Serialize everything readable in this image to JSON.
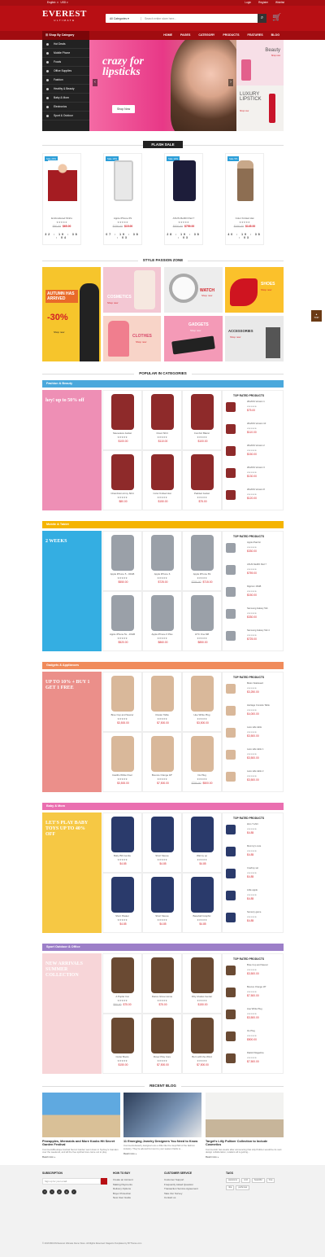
{
  "topbar": {
    "language": "English",
    "currency": "USD",
    "login": "Login",
    "register": "Register",
    "wishlist": "Wishlist"
  },
  "header": {
    "logo": "EVEREST",
    "logo_sub": "ULTIMATE",
    "search_category": "All Categories",
    "search_placeholder": "Search entire store here..."
  },
  "nav": {
    "shop_by_category": "Shop By Category",
    "items": [
      "HOME",
      "PAGES",
      "CATEGORY",
      "PRODUCTS",
      "FEATURES",
      "BLOG"
    ]
  },
  "side_menu": [
    "Hot Deals",
    "Mobile Phone",
    "Foods",
    "Office Supplies",
    "Fashion",
    "Healthy & Beauty",
    "Baby & Mom",
    "Electronics",
    "Sport & Outdoor"
  ],
  "slider": {
    "title_line1": "crazy for",
    "title_line2": "lipsticks",
    "button": "Shop Now"
  },
  "side_banners": [
    {
      "title": "Beauty",
      "sub": "Shop now"
    },
    {
      "title": "LUXURY LIPSTICK",
      "sub": "Shop now"
    }
  ],
  "flash_sale": {
    "title": "FLASH SALE",
    "products": [
      {
        "badge": "Sale 20%",
        "name": "Embroidered Shirts",
        "rating": "★★★★★",
        "old_price": "$80.00",
        "price": "$65.00",
        "countdown": "32 : 19 : 38 : 04"
      },
      {
        "badge": "Sale 10%",
        "name": "Apple iPhone 6S",
        "rating": "★★★★★",
        "old_price": "$750.00",
        "price": "$15.00",
        "countdown": "07 : 19 : 38 : 03"
      },
      {
        "badge": "Sale 12%",
        "name": "ASUS MeMO Pad 7",
        "rating": "★★★★★",
        "old_price": "$820.00",
        "price": "$759.00",
        "countdown": "28 : 19 : 38 : 03"
      },
      {
        "badge": "Sale 5%",
        "name": "Color Knitted Hat",
        "rating": "★★★★★",
        "old_price": "$160.00",
        "price": "$145.00",
        "countdown": "40 : 19 : 38 : 03"
      }
    ]
  },
  "style_zone": {
    "title": "STYLE PASSION ZONE",
    "tiles": [
      {
        "label": "AUTUMN HAS ARRIVED",
        "extra": "-30%",
        "sub": "Shop now"
      },
      {
        "label": "COSMETICS",
        "sub": "Shop now"
      },
      {
        "label": "WATCH",
        "sub": "Shop now"
      },
      {
        "label": "SHOES",
        "sub": "Shop now"
      },
      {
        "label": "CLOTHES",
        "sub": "Shop now"
      },
      {
        "label": "GADGETS",
        "sub": "Shop now"
      },
      {
        "label": "ACCESSORIES",
        "sub": "Shop now"
      }
    ]
  },
  "popular": {
    "title": "POPULAR IN CATEGORIES",
    "top_rated": "TOP RATED PRODUCTS",
    "categories": [
      {
        "name": "Fashion & Beauty",
        "color": "#4aa8dc",
        "banner": "hey! up to 50% off",
        "banner_color": "#ee8fb5",
        "products": [
          {
            "name": "Sleeveless Jacket",
            "old": "",
            "price": "$100.00"
          },
          {
            "name": "Cloud Shirt",
            "old": "",
            "price": "$110.00"
          },
          {
            "name": "Comfort Blazer",
            "old": "",
            "price": "$100.00"
          },
          {
            "name": "Chambrain Army Shirt",
            "old": "",
            "price": "$80.00"
          },
          {
            "name": "Color Knitted Hat",
            "old": "",
            "price": "$150.00"
          },
          {
            "name": "Padded Jacket",
            "old": "",
            "price": "$75.00"
          }
        ],
        "top": [
          {
            "name": "WHASS Version 1",
            "price": "$75.00"
          },
          {
            "name": "WHASS Version 10",
            "price": "$110.00"
          },
          {
            "name": "WHASS Version 2",
            "price": "$150.00"
          },
          {
            "name": "WHASS Version 3",
            "price": "$130.00"
          },
          {
            "name": "WHASS Version 8",
            "price": "$120.00"
          }
        ]
      },
      {
        "name": "Mobile & Tablet",
        "color": "#f5b400",
        "banner": "2 WEEKS",
        "banner_color": "#34aee2",
        "products": [
          {
            "name": "Apple iPhone 5 - 32GB",
            "old": "",
            "price": "$550.00"
          },
          {
            "name": "Apple iPhone 6",
            "old": "",
            "price": "$725.00"
          },
          {
            "name": "Apple iPhone 6S",
            "old": "$750.00",
            "price": "$715.00"
          },
          {
            "name": "Apple iPhone 5s - 16GB",
            "old": "",
            "price": "$520.00"
          },
          {
            "name": "Apple iPhone 6 Plus",
            "old": "",
            "price": "$860.00"
          },
          {
            "name": "HTC One M8",
            "old": "",
            "price": "$850.00"
          }
        ],
        "top": [
          {
            "name": "Apple iPad Air",
            "price": "$330.00"
          },
          {
            "name": "ASUS MeMO Pad 7",
            "price": "$759.00"
          },
          {
            "name": "Digicom 16GB",
            "price": "$150.00"
          },
          {
            "name": "Samsung Galaxy Tab",
            "price": "$330.00"
          },
          {
            "name": "Samsung Galaxy Tab 4",
            "price": "$725.00"
          }
        ]
      },
      {
        "name": "Gadgets & Appliances",
        "color": "#f08b5b",
        "banner": "UP TO 10% + BUY 1 GET 1 FREE",
        "banner_color": "#eb8f8a",
        "products": [
          {
            "name": "Bree Cup and Saucer",
            "old": "",
            "price": "$3,500.00"
          },
          {
            "name": "Cluster Table",
            "old": "",
            "price": "$7,500.00"
          },
          {
            "name": "Hue White Plug",
            "old": "",
            "price": "$3,500.00"
          },
          {
            "name": "Castillo White Floor",
            "old": "",
            "price": "$3,500.00"
          },
          {
            "name": "Bounce Orange 18\"",
            "old": "",
            "price": "$7,500.00"
          },
          {
            "name": "Iris Plug",
            "old": "$750.00",
            "price": "$500.00"
          }
        ],
        "top": [
          {
            "name": "Bistro Sideboard",
            "price": "$3,250.00"
          },
          {
            "name": "Heritage Console Table",
            "price": "$4,000.00"
          },
          {
            "name": "Lace side table",
            "price": "$3,500.00"
          },
          {
            "name": "Lace side table 1",
            "price": "$3,500.00"
          },
          {
            "name": "Lace side table 2",
            "price": "$3,500.00"
          }
        ]
      },
      {
        "name": "Baby & Mom",
        "color": "#ea6fb0",
        "banner": "LET'S PLAY BABY TOYS UP TO 40% OFF",
        "banner_color": "#f6c844",
        "products": [
          {
            "name": "Baby Bib Gentle",
            "old": "",
            "price": "$4.85"
          },
          {
            "name": "Short Sleeve",
            "old": "",
            "price": "$4.85"
          },
          {
            "name": "Warmy up",
            "old": "",
            "price": "$4.85"
          },
          {
            "name": "Short Pleater",
            "old": "",
            "price": "$4.85"
          },
          {
            "name": "Short Sleeve",
            "old": "",
            "price": "$4.85"
          },
          {
            "name": "Baseball Graphic",
            "old": "",
            "price": "$4.85"
          }
        ],
        "top": [
          {
            "name": "Zero T-shirt",
            "price": "$4.85"
          },
          {
            "name": "Mommy's cute",
            "price": "$4.85"
          },
          {
            "name": "Cowboy set",
            "price": "$4.85"
          },
          {
            "name": "Little apple",
            "price": "$4.85"
          },
          {
            "name": "Sensory game",
            "price": "$4.85"
          }
        ]
      },
      {
        "name": "Sport Outdoor & Office",
        "color": "#9c7fc8",
        "banner": "NEW ARRIVALS SUMMER COLLECTION",
        "banner_color": "#f7d5d8",
        "products": [
          {
            "name": "A Poplar Cat",
            "old": "$80.00",
            "price": "$75.00"
          },
          {
            "name": "Dance Glove Home",
            "old": "",
            "price": "$75.00"
          },
          {
            "name": "Fifty shades Genter",
            "old": "",
            "price": "$150.00"
          },
          {
            "name": "Cutter Boots",
            "old": "",
            "price": "$150.00"
          },
          {
            "name": "Rover Play Core",
            "old": "",
            "price": "$7,500.00"
          },
          {
            "name": "Born with the Wind",
            "old": "",
            "price": "$7,500.00"
          }
        ],
        "top": [
          {
            "name": "Bree Cup and Saucer",
            "price": "$3,500.00"
          },
          {
            "name": "Bounce Orange 18\"",
            "price": "$7,500.00"
          },
          {
            "name": "Hue White Plug",
            "price": "$3,500.00"
          },
          {
            "name": "Iris Plug",
            "price": "$500.00"
          },
          {
            "name": "Rattish Magazine",
            "price": "$7,500.00"
          }
        ]
      }
    ]
  },
  "blog": {
    "title": "RECENT BLOG",
    "posts": [
      {
        "title": "Pineapples, Mermaids and More Kooks Hit Secret Garden Festival",
        "desc": "CommentsBoutique festival Secret Garden went down in Sydney's Camden over the weekend, and all the free spirited love came out to play.",
        "more": "Read more »"
      },
      {
        "title": "11 Emerging Jewelry Designers You Need to Know",
        "desc": "CommentsJewelry designers are a little like the stepchild of the fashion industry. They're adored but next to your season fields re...",
        "more": "Read more »"
      },
      {
        "title": "Target's Lilly Pulitzer Collection to Include Cosmetics",
        "desc": "CommentsIt has weeks after announcing that Lilly Pulitzer would be its next design collaboration, retailers all is getting...",
        "more": "Read more »"
      }
    ]
  },
  "footer": {
    "subscription": "SUBSCRIPTION",
    "email_placeholder": "Sign up for your email",
    "how_to_buy": {
      "title": "HOW TO BUY",
      "items": [
        "Create an Account",
        "Making Payments",
        "Delivery Options",
        "Buyer Protection",
        "New User Guide"
      ]
    },
    "customer_service": {
      "title": "CUSTOMER SERVICE",
      "items": [
        "Customer Support",
        "Frequently Asked Question",
        "Transaction Service Agreement",
        "Take Our Survey",
        "Contact us"
      ]
    },
    "tags": {
      "title": "TAGS",
      "items": [
        "awesome",
        "cool",
        "beautiful",
        "love",
        "nba",
        "perfumes"
      ]
    },
    "copyright": "© 2016 BFCOM Everest Ultimate Demo Store. All Rights Reserved. Magento Templates by BYTheme.com"
  },
  "totop": "TOP"
}
